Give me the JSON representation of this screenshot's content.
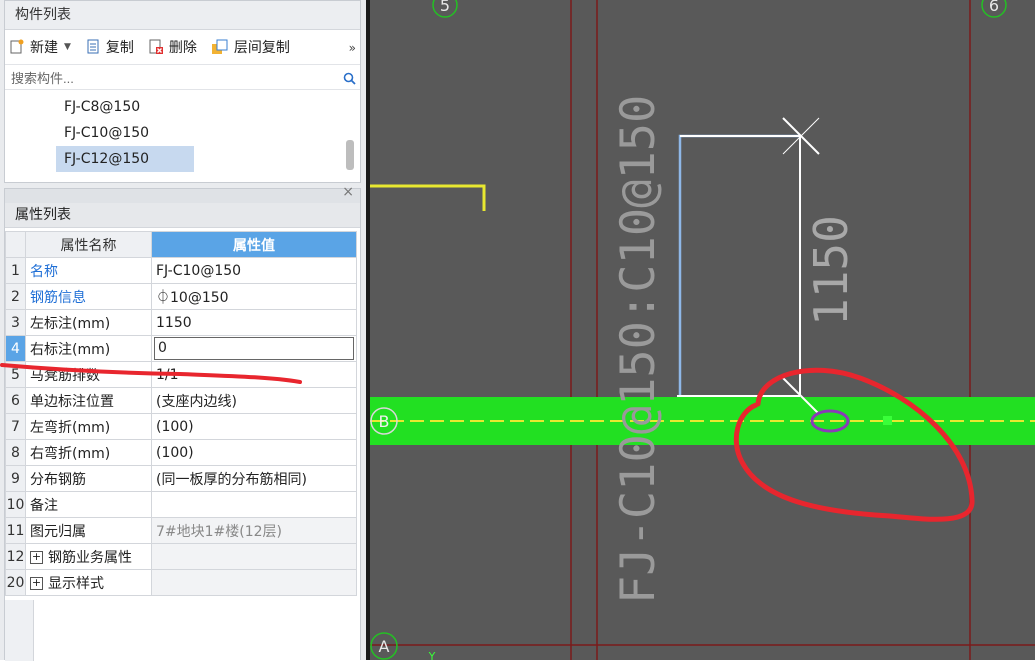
{
  "component_list": {
    "title": "构件列表",
    "toolbar": {
      "new_label": "新建",
      "copy_label": "复制",
      "delete_label": "删除",
      "floor_copy_label": "层间复制",
      "more": "»"
    },
    "search_placeholder": "搜索构件...",
    "items": [
      "FJ-C8@150",
      "FJ-C10@150",
      "FJ-C12@150"
    ],
    "selected_item": "FJ-C12@150"
  },
  "property_list": {
    "close": "×",
    "title": "属性列表",
    "col_name": "属性名称",
    "col_value": "属性值",
    "rows": [
      {
        "num": "1",
        "name": "名称",
        "value": "FJ-C10@150"
      },
      {
        "num": "2",
        "name": "钢筋信息",
        "value": "⏀10@150"
      },
      {
        "num": "3",
        "name": "左标注(mm)",
        "value": "1150"
      },
      {
        "num": "4",
        "name": "右标注(mm)",
        "value": "0"
      },
      {
        "num": "5",
        "name": "马凳筋排数",
        "value": "1/1"
      },
      {
        "num": "6",
        "name": "单边标注位置",
        "value": "(支座内边线)"
      },
      {
        "num": "7",
        "name": "左弯折(mm)",
        "value": "(100)"
      },
      {
        "num": "8",
        "name": "右弯折(mm)",
        "value": "(100)"
      },
      {
        "num": "9",
        "name": "分布钢筋",
        "value": "(同一板厚的分布筋相同)"
      },
      {
        "num": "10",
        "name": "备注",
        "value": ""
      },
      {
        "num": "11",
        "name": "图元归属",
        "value": "7#地块1#楼(12层)"
      },
      {
        "num": "12",
        "name": "钢筋业务属性",
        "value": ""
      },
      {
        "num": "20",
        "name": "显示样式",
        "value": ""
      }
    ]
  },
  "canvas": {
    "axis_5": "5",
    "axis_6": "6",
    "axis_B": "B",
    "axis_A": "A",
    "rebar_label": "FJ-C10@150:C10@150",
    "dimension": "1150",
    "y_axis": "Y"
  },
  "colors": {
    "slab_green": "#22e022",
    "canvas_bg": "#595959",
    "annotation_red": "#e8262e",
    "selection_blue": "#5aa4e6"
  }
}
